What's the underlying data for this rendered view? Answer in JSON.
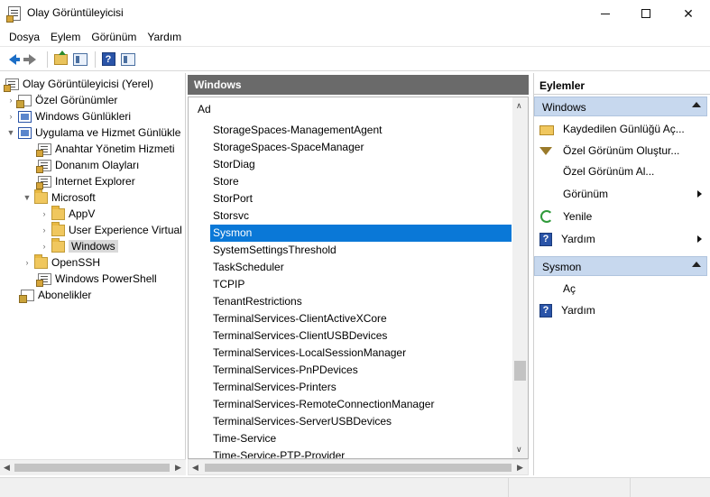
{
  "window": {
    "title": "Olay Görüntüleyicisi",
    "close_glyph": "✕"
  },
  "menu": [
    "Dosya",
    "Eylem",
    "Görünüm",
    "Yardım"
  ],
  "toolbar": {
    "help_glyph": "?",
    "icons": [
      "back-arrow-icon",
      "forward-arrow-icon",
      "folder-up-icon",
      "show-hide-tree-icon",
      "help-icon",
      "action-pane-icon"
    ]
  },
  "tree": {
    "root": "Olay Görüntüleyicisi (Yerel)",
    "custom_views": "Özel Görünümler",
    "windows_logs": "Windows Günlükleri",
    "app_services": "Uygulama ve Hizmet Günlükle",
    "key_mgmt": "Anahtar Yönetim Hizmeti",
    "hardware": "Donanım Olayları",
    "ie": "Internet Explorer",
    "microsoft": "Microsoft",
    "appv": "AppV",
    "uev": "User Experience Virtual",
    "windows": "Windows",
    "openssh": "OpenSSH",
    "powershell": "Windows PowerShell",
    "subscriptions": "Abonelikler",
    "expanded_glyph": "▼",
    "collapsed_glyph": "›"
  },
  "middle": {
    "header": "Windows",
    "column": "Ad",
    "selected_index": 6,
    "items": [
      "StorageSpaces-ManagementAgent",
      "StorageSpaces-SpaceManager",
      "StorDiag",
      "Store",
      "StorPort",
      "Storsvc",
      "Sysmon",
      "SystemSettingsThreshold",
      "TaskScheduler",
      "TCPIP",
      "TenantRestrictions",
      "TerminalServices-ClientActiveXCore",
      "TerminalServices-ClientUSBDevices",
      "TerminalServices-LocalSessionManager",
      "TerminalServices-PnPDevices",
      "TerminalServices-Printers",
      "TerminalServices-RemoteConnectionManager",
      "TerminalServices-ServerUSBDevices",
      "Time-Service",
      "Time-Service-PTP-Provider"
    ],
    "scroll_up": "∧",
    "scroll_down": "∨"
  },
  "actions": {
    "title": "Eylemler",
    "section1": "Windows",
    "open_saved": "Kaydedilen Günlüğü Aç...",
    "create_view": "Özel Görünüm Oluştur...",
    "import_view": "Özel Görünüm Al...",
    "view": "Görünüm",
    "refresh": "Yenile",
    "help": "Yardım",
    "section2": "Sysmon",
    "open": "Aç",
    "help2": "Yardım",
    "help_glyph": "?"
  },
  "colors": {
    "selection": "#0a78d7",
    "header_bg": "#6a6a6a",
    "action_section_bg": "#c7d8ee"
  }
}
